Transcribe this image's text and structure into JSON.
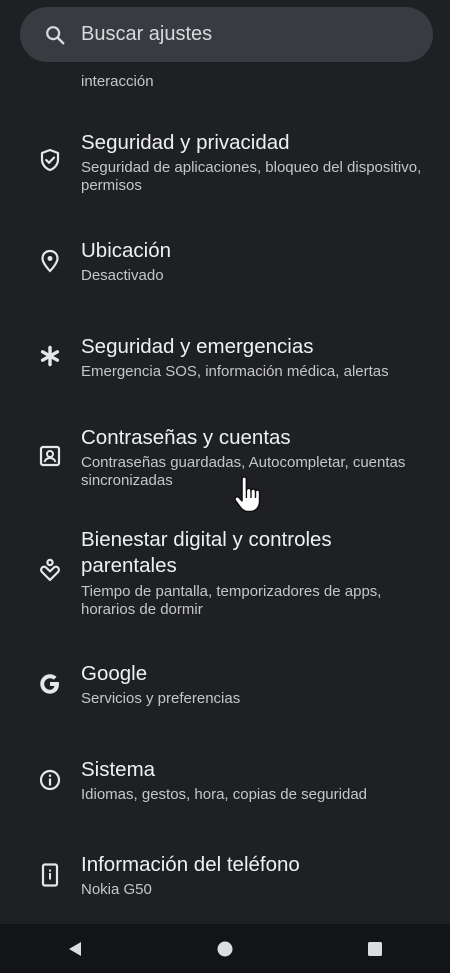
{
  "search": {
    "placeholder": "Buscar ajustes",
    "icon": "search-icon"
  },
  "clipped_item": {
    "subtitle": "interacción"
  },
  "settings": [
    {
      "icon": "shield-check-icon",
      "title": "Seguridad y privacidad",
      "subtitle": "Seguridad de aplicaciones, bloqueo del dispositivo, permisos"
    },
    {
      "icon": "location-pin-icon",
      "title": "Ubicación",
      "subtitle": "Desactivado"
    },
    {
      "icon": "asterisk-icon",
      "title": "Seguridad y emergencias",
      "subtitle": "Emergencia SOS, información médica, alertas"
    },
    {
      "icon": "account-box-icon",
      "title": "Contraseñas y cuentas",
      "subtitle": "Contraseñas guardadas, Autocompletar, cuentas sincronizadas"
    },
    {
      "icon": "digital-wellbeing-icon",
      "title_line1": "Bienestar digital y controles",
      "title_line2": "parentales",
      "subtitle": "Tiempo de pantalla, temporizadores de apps, horarios de dormir"
    },
    {
      "icon": "google-g-icon",
      "title": "Google",
      "subtitle": "Servicios y preferencias"
    },
    {
      "icon": "info-icon",
      "title": "Sistema",
      "subtitle": "Idiomas, gestos, hora, copias de seguridad"
    },
    {
      "icon": "phone-info-icon",
      "title": "Información del teléfono",
      "subtitle": "Nokia G50"
    }
  ],
  "navbar": {
    "back": "back-triangle-icon",
    "home": "home-circle-icon",
    "recents": "recents-square-icon"
  },
  "colors": {
    "background": "#1f2024",
    "search_background": "#3a3b40",
    "navbar_background": "#131417",
    "text_primary": "#eef0f3",
    "text_secondary": "#c4c6cc"
  }
}
